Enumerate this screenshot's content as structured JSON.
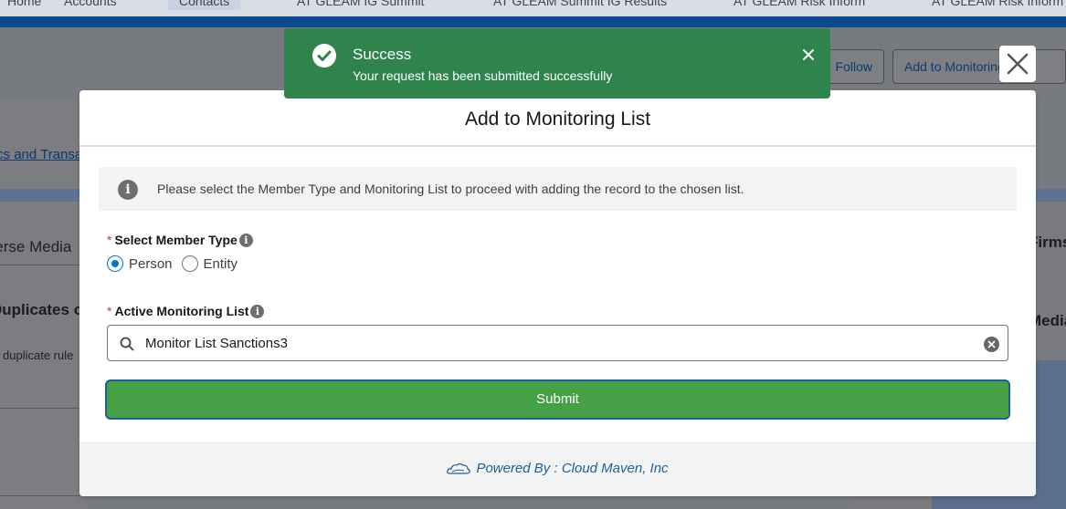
{
  "background": {
    "nav_tabs": [
      "Home",
      "Accounts",
      "Contacts",
      "AT GLEAM IG Summit",
      "AT GLEAM Summit IG Results",
      "AT GLEAM Risk Inform",
      "AT GLEAM Risk Inform"
    ],
    "follow_label": "Follow",
    "add_to_monitoring_label": "Add to Monitoring List",
    "texts": {
      "analytics": "Analytics and Transactions",
      "adverse_media": "Adverse Media",
      "duplicates_heading": "Duplicates of",
      "duplicate_rule": "The duplicate rule",
      "firms": "Firms",
      "media": "Media"
    }
  },
  "toast": {
    "title": "Success",
    "message": "Your request has been submitted successfully",
    "variant": "success",
    "color": "#2e844a",
    "icon": "check-circle-icon",
    "close_icon": "close-icon"
  },
  "modal": {
    "title": "Add to Monitoring List",
    "close_icon": "close-icon",
    "info_icon": "info-icon",
    "info_text": "Please select the Member Type and Monitoring List to proceed with adding the record to the chosen list.",
    "member_type": {
      "required_mark": "*",
      "label": "Select Member Type",
      "help_icon": "help-icon",
      "options": [
        {
          "label": "Person",
          "selected": true
        },
        {
          "label": "Entity",
          "selected": false
        }
      ]
    },
    "monitoring_list": {
      "required_mark": "*",
      "label": "Active Monitoring List",
      "help_icon": "help-icon",
      "search_icon": "search-icon",
      "value": "Monitor List Sanctions3",
      "clear_icon": "clear-icon"
    },
    "submit_label": "Submit",
    "submit_color": "#45a046",
    "footer": {
      "logo_icon": "cloud-icon",
      "text": "Powered By : Cloud Maven, Inc"
    }
  }
}
